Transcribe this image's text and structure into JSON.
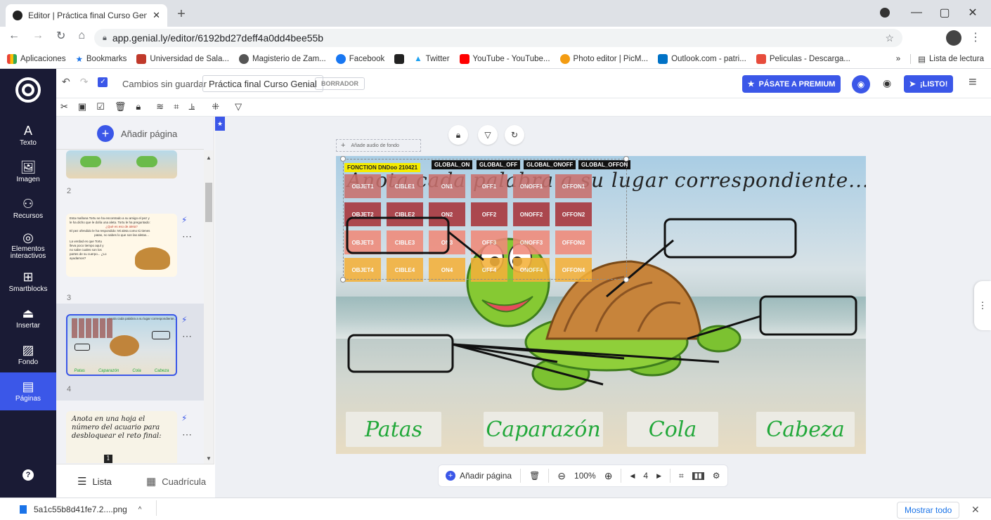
{
  "browser": {
    "tab_title": "Editor | Práctica final Curso Genial",
    "url": "app.genial.ly/editor/6192bd27deff4a0dd4bee55b",
    "bookmarks": [
      "Aplicaciones",
      "Bookmarks",
      "Universidad de Sala...",
      "Magisterio de Zam...",
      "Facebook",
      "",
      "Twitter",
      "YouTube - YouTube...",
      "Photo editor | PicM...",
      "Outlook.com - patri...",
      "Peliculas - Descarga..."
    ],
    "reading_list": "Lista de lectura",
    "more": "»"
  },
  "app": {
    "status": "Cambios sin guardar",
    "doc_title": "Práctica final Curso Genial",
    "draft_badge": "BORRADOR",
    "premium_button": "PÁSATE A PREMIUM",
    "done_button": "¡LISTO!"
  },
  "sidebar": {
    "items": [
      {
        "label": "Texto",
        "icon": "text-icon"
      },
      {
        "label": "Imagen",
        "icon": "image-icon"
      },
      {
        "label": "Recursos",
        "icon": "resources-icon"
      },
      {
        "label": "Elementos interactivos",
        "icon": "interactive-icon"
      },
      {
        "label": "Smartblocks",
        "icon": "smartblocks-icon"
      },
      {
        "label": "Insertar",
        "icon": "insert-icon"
      },
      {
        "label": "Fondo",
        "icon": "background-icon"
      },
      {
        "label": "Páginas",
        "icon": "pages-icon"
      }
    ]
  },
  "pages_panel": {
    "add_page": "Añadir página",
    "page_numbers": [
      "2",
      "3",
      "4"
    ],
    "thumb3_lines": [
      "Esta mañana Tortu se ha encontrado a su amigo el pez y",
      "le ha dicho que le dolía una aleta. Tortu le ha preguntado:",
      "¿Qué es eso de aleta?",
      "El pez ofendido le ha respondido: Mi aleta como tú tienes",
      "patas, no sabes lo que son las aletas...",
      "La verdad es que Tortu",
      "lleva poco tiempo aquí y",
      "no sabe cuales son los",
      "partes de su cuerpo... ¿Lo",
      "ayudamos?"
    ],
    "thumb4_title": "Anota cada palabra a su lugar correspondiente...",
    "thumb4_labels": [
      "Patas",
      "Caparazón",
      "Cola",
      "Cabeza"
    ],
    "thumb5_text": "Anota en una hoja el número del acuario para desbloquear el reto final:",
    "thumb5_badge": "1",
    "view_list": "Lista",
    "view_grid": "Cuadrícula"
  },
  "canvas": {
    "audio_label": "Añade audio de fondo",
    "title": "Anota cada palabra a su lugar correspondiente...",
    "tags": [
      "FONCTION DNDoo 210421",
      "GLOBAL_ON",
      "GLOBAL_OFF",
      "GLOBAL_ONOFF",
      "GLOBAL_OFFON"
    ],
    "grid": [
      [
        "OBJET1",
        "CIBLE1",
        "ON1",
        "OFF1",
        "ONOFF1",
        "OFFON1"
      ],
      [
        "OBJET2",
        "CIBLE2",
        "ON2",
        "OFF2",
        "ONOFF2",
        "OFFON2"
      ],
      [
        "OBJET3",
        "CIBLE3",
        "ON3",
        "OFF3",
        "ONOFF3",
        "OFFON3"
      ],
      [
        "OBJET4",
        "CIBLE4",
        "ON4",
        "OFF4",
        "ONOFF4",
        "OFFON4"
      ]
    ],
    "row_colors": [
      "#c9706d",
      "#a8343a",
      "#f08a7a",
      "#f4b13a"
    ],
    "labels": [
      "Patas",
      "Caparazón",
      "Cola",
      "Cabeza"
    ]
  },
  "bottom_bar": {
    "add_page": "Añadir página",
    "zoom": "100%",
    "page": "4"
  },
  "download": {
    "file": "5a1c55b8d41fe7.2....png",
    "show_all": "Mostrar todo"
  }
}
